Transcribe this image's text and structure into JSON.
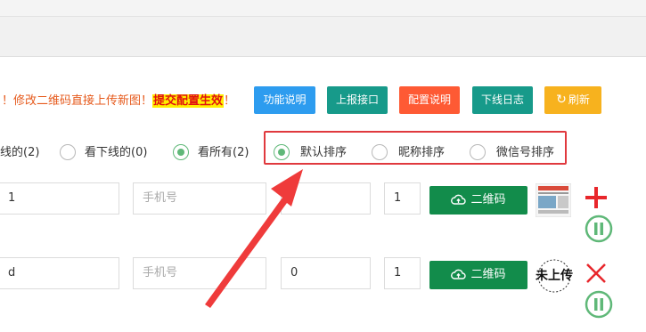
{
  "notice": {
    "text": "！修改二维码直接上传新图！",
    "highlight": "提交配置生效",
    "tail": "！"
  },
  "toolbar": {
    "func_desc": "功能说明",
    "report_api": "上报接口",
    "config_desc": "配置说明",
    "offline_log": "下线日志",
    "refresh": "刷新",
    "refresh_icon": "refresh-icon"
  },
  "filters": {
    "online_partial": "线的(2)",
    "offline": "看下线的(0)",
    "all": "看所有(2)",
    "selected": "all"
  },
  "sort": {
    "default": "默认排序",
    "nickname": "昵称排序",
    "wechat": "微信号排序",
    "selected": "default"
  },
  "rows": [
    {
      "field1": "1",
      "phone_placeholder": "手机号",
      "num": "",
      "count": "1",
      "qr_label": "二维码",
      "thumb": "qr-image-thumbnail",
      "action": "plus"
    },
    {
      "field1": "d",
      "phone_placeholder": "手机号",
      "num": "0",
      "count": "1",
      "qr_label": "二维码",
      "thumb_text": "未上传",
      "action": "close"
    }
  ],
  "colors": {
    "accent_green": "#128c4b",
    "red": "#e0393e",
    "pause_green": "#5fb878"
  }
}
